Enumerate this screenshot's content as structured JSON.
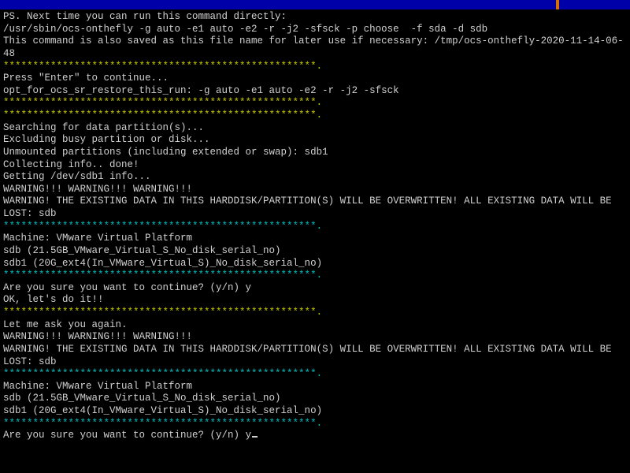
{
  "lines": [
    {
      "cls": "white",
      "text": "PS. Next time you can run this command directly:"
    },
    {
      "cls": "white",
      "text": "/usr/sbin/ocs-onthefly -g auto -e1 auto -e2 -r -j2 -sfsck -p choose  -f sda -d sdb"
    },
    {
      "cls": "white",
      "text": "This command is also saved as this file name for later use if necessary: /tmp/ocs-onthefly-2020-11-14-06-48"
    },
    {
      "cls": "yellow",
      "text": "*****************************************************."
    },
    {
      "cls": "white",
      "text": "Press \"Enter\" to continue..."
    },
    {
      "cls": "white",
      "text": "opt_for_ocs_sr_restore_this_run: -g auto -e1 auto -e2 -r -j2 -sfsck"
    },
    {
      "cls": "yellow",
      "text": "*****************************************************."
    },
    {
      "cls": "yellow",
      "text": "*****************************************************."
    },
    {
      "cls": "white",
      "text": "Searching for data partition(s)..."
    },
    {
      "cls": "white",
      "text": "Excluding busy partition or disk..."
    },
    {
      "cls": "white",
      "text": "Unmounted partitions (including extended or swap): sdb1"
    },
    {
      "cls": "white",
      "text": "Collecting info.. done!"
    },
    {
      "cls": "white",
      "text": "Getting /dev/sdb1 info..."
    },
    {
      "cls": "white",
      "text": "WARNING!!! WARNING!!! WARNING!!!"
    },
    {
      "cls": "white",
      "text": "WARNING! THE EXISTING DATA IN THIS HARDDISK/PARTITION(S) WILL BE OVERWRITTEN! ALL EXISTING DATA WILL BE LOST: sdb"
    },
    {
      "cls": "cyan",
      "text": "*****************************************************."
    },
    {
      "cls": "white",
      "text": "Machine: VMware Virtual Platform"
    },
    {
      "cls": "white",
      "text": "sdb (21.5GB_VMware_Virtual_S_No_disk_serial_no)"
    },
    {
      "cls": "white",
      "text": "sdb1 (20G_ext4(In_VMware_Virtual_S)_No_disk_serial_no)"
    },
    {
      "cls": "cyan",
      "text": "*****************************************************."
    },
    {
      "cls": "white",
      "text": "Are you sure you want to continue? (y/n) y"
    },
    {
      "cls": "white",
      "text": "OK, let's do it!!"
    },
    {
      "cls": "yellow",
      "text": "*****************************************************."
    },
    {
      "cls": "white",
      "text": "Let me ask you again."
    },
    {
      "cls": "white",
      "text": "WARNING!!! WARNING!!! WARNING!!!"
    },
    {
      "cls": "white",
      "text": "WARNING! THE EXISTING DATA IN THIS HARDDISK/PARTITION(S) WILL BE OVERWRITTEN! ALL EXISTING DATA WILL BE LOST: sdb"
    },
    {
      "cls": "cyan",
      "text": "*****************************************************."
    },
    {
      "cls": "white",
      "text": "Machine: VMware Virtual Platform"
    },
    {
      "cls": "white",
      "text": "sdb (21.5GB_VMware_Virtual_S_No_disk_serial_no)"
    },
    {
      "cls": "white",
      "text": "sdb1 (20G_ext4(In_VMware_Virtual_S)_No_disk_serial_no)"
    },
    {
      "cls": "cyan",
      "text": "*****************************************************."
    }
  ],
  "prompt": {
    "text": "Are you sure you want to continue? (y/n) ",
    "input": "y"
  }
}
